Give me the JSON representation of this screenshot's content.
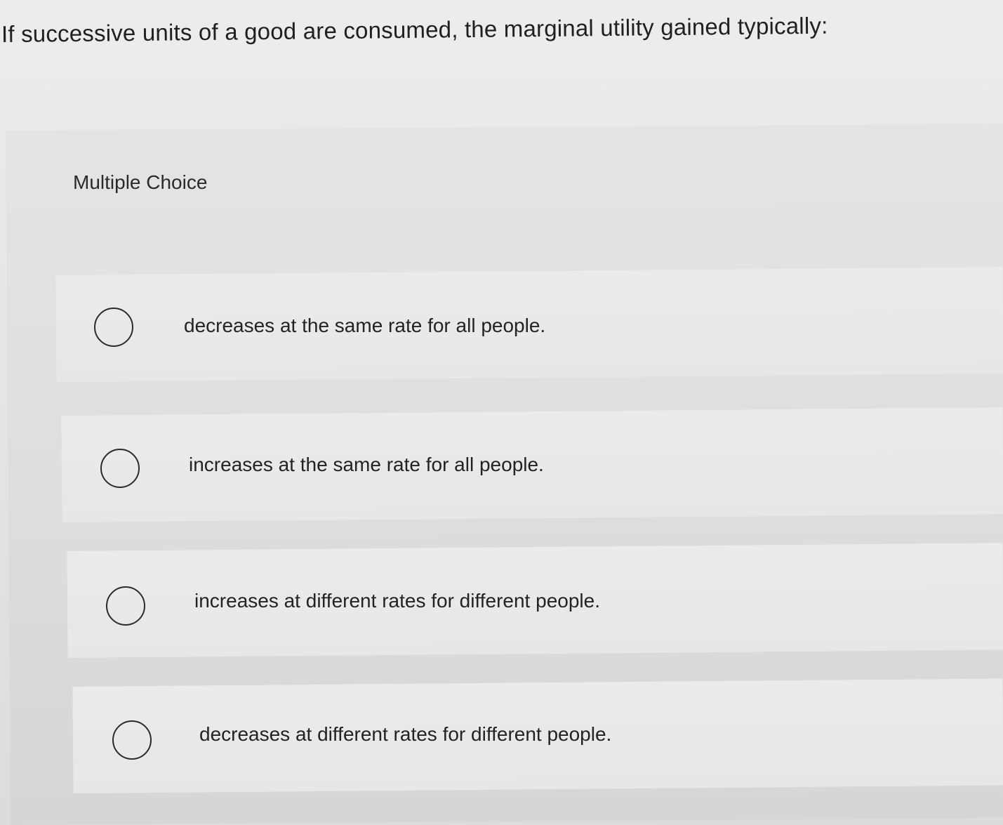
{
  "question": {
    "text": "If successive units of a good are consumed, the marginal utility gained typically:"
  },
  "answer_section": {
    "type_label": "Multiple Choice",
    "options": [
      {
        "label": "decreases at the same rate for all people.",
        "selected": false
      },
      {
        "label": "increases at the same rate for all people.",
        "selected": false
      },
      {
        "label": "increases at different rates for different people.",
        "selected": false
      },
      {
        "label": "decreases at different rates for different people.",
        "selected": false
      }
    ]
  }
}
